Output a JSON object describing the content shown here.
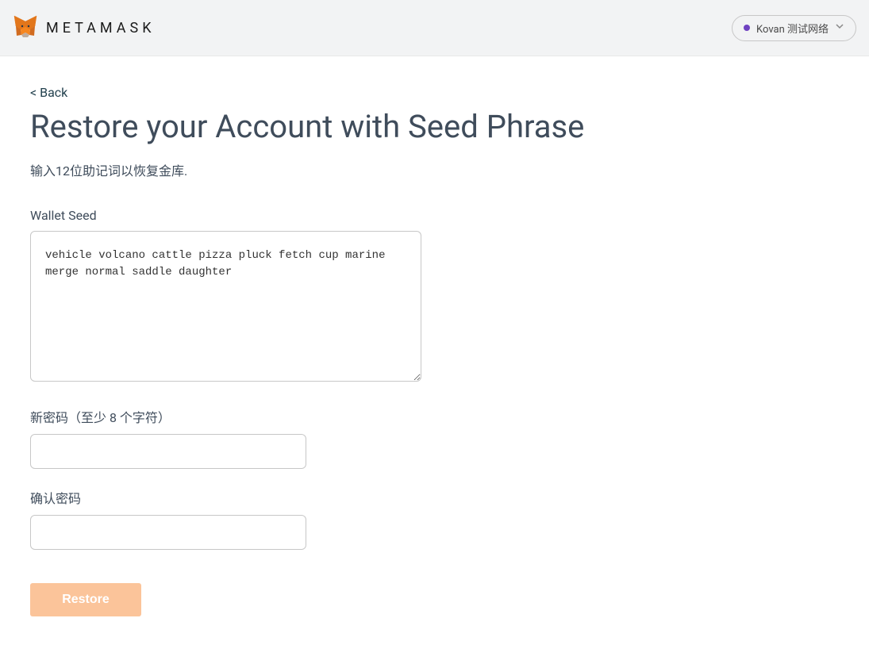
{
  "header": {
    "brand": "METAMASK",
    "network_label": "Kovan 测试网络"
  },
  "page": {
    "back_label": "< Back",
    "title": "Restore your Account with Seed Phrase",
    "subtitle": "输入12位助记词以恢复金库.",
    "wallet_seed_label": "Wallet Seed",
    "wallet_seed_value": "vehicle volcano cattle pizza pluck fetch cup marine merge normal saddle daughter",
    "new_password_label": "新密码（至少 8 个字符）",
    "new_password_value": "",
    "confirm_password_label": "确认密码",
    "confirm_password_value": "",
    "restore_button_label": "Restore"
  }
}
